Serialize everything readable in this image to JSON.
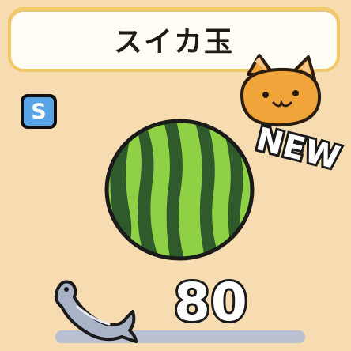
{
  "item": {
    "name": "スイカ玉",
    "rank": "S",
    "new_label": "NEW",
    "price": "80",
    "price_icon": "silver-fish-icon"
  },
  "colors": {
    "background": "#f6dcb0",
    "title_border": "#f3c866",
    "rank_badge": "#58a4e6",
    "cat_orange": "#f0a43a",
    "melon_light": "#8ed144",
    "melon_dark": "#2f5a2b",
    "fish_silver": "#a9b2c6"
  }
}
